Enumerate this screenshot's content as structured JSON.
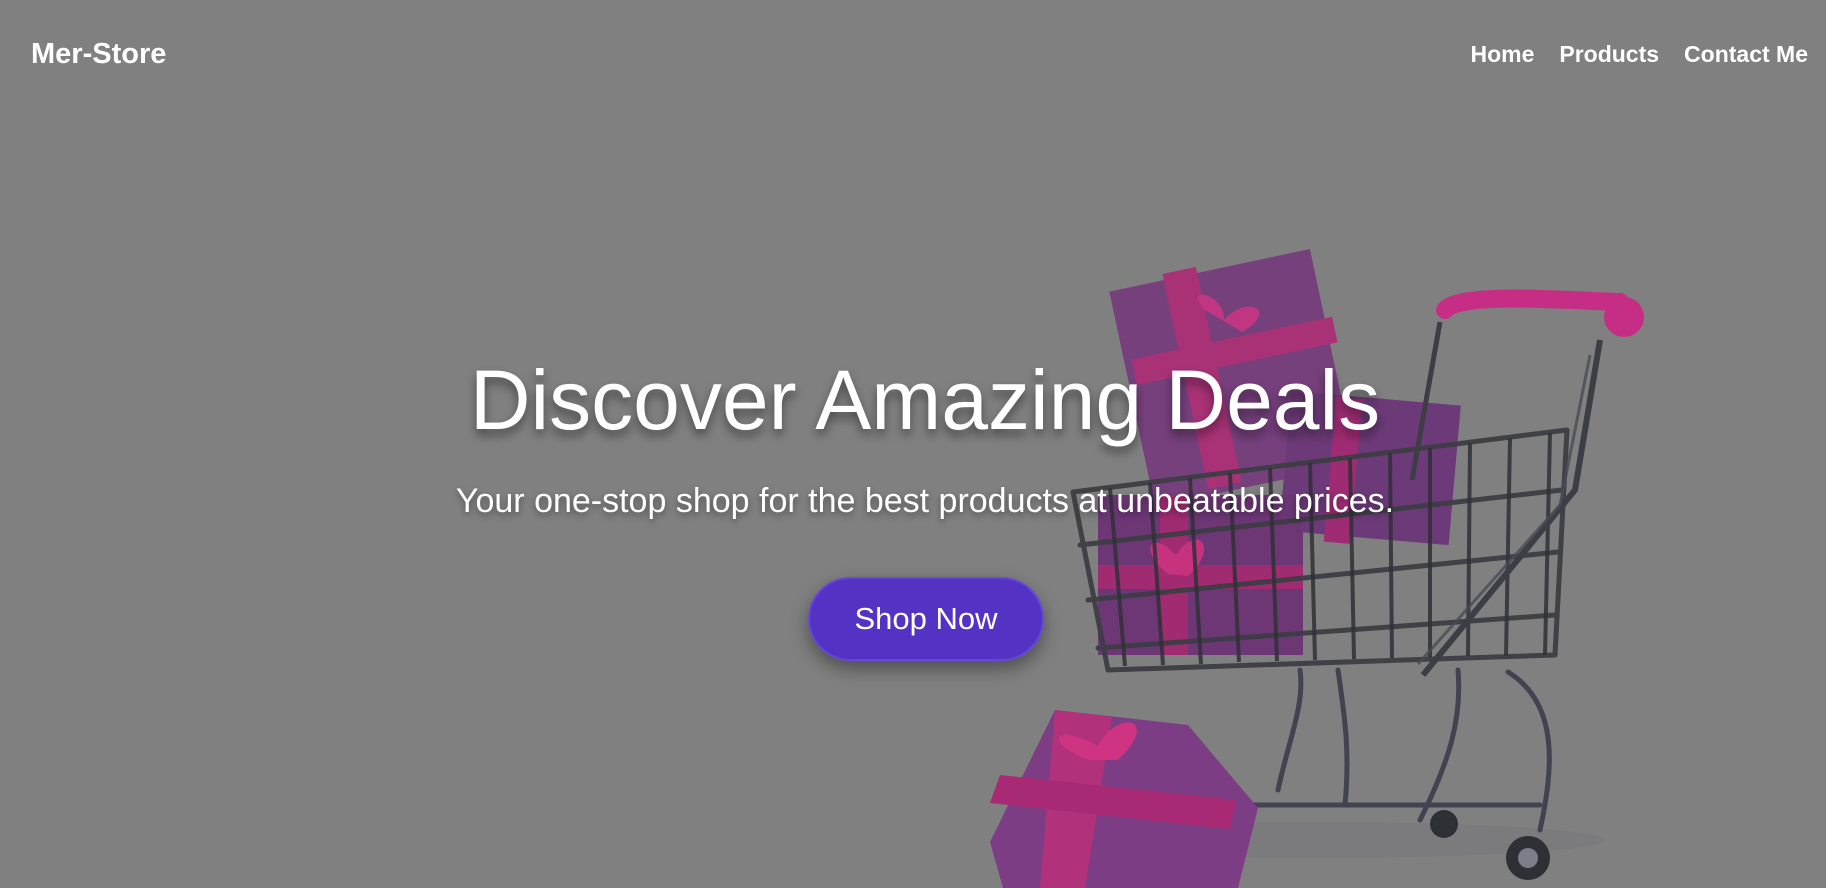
{
  "navbar": {
    "brand": "Mer-Store",
    "links": [
      "Home",
      "Products",
      "Contact Me"
    ]
  },
  "hero": {
    "title": "Discover Amazing Deals",
    "subtitle": "Your one-stop shop for the best products at unbeatable prices.",
    "cta_label": "Shop Now"
  },
  "colors": {
    "overlay": "#808080",
    "button": "#5433c4",
    "text": "#ffffff"
  },
  "icons": {
    "background": "shopping-cart-with-gifts"
  }
}
